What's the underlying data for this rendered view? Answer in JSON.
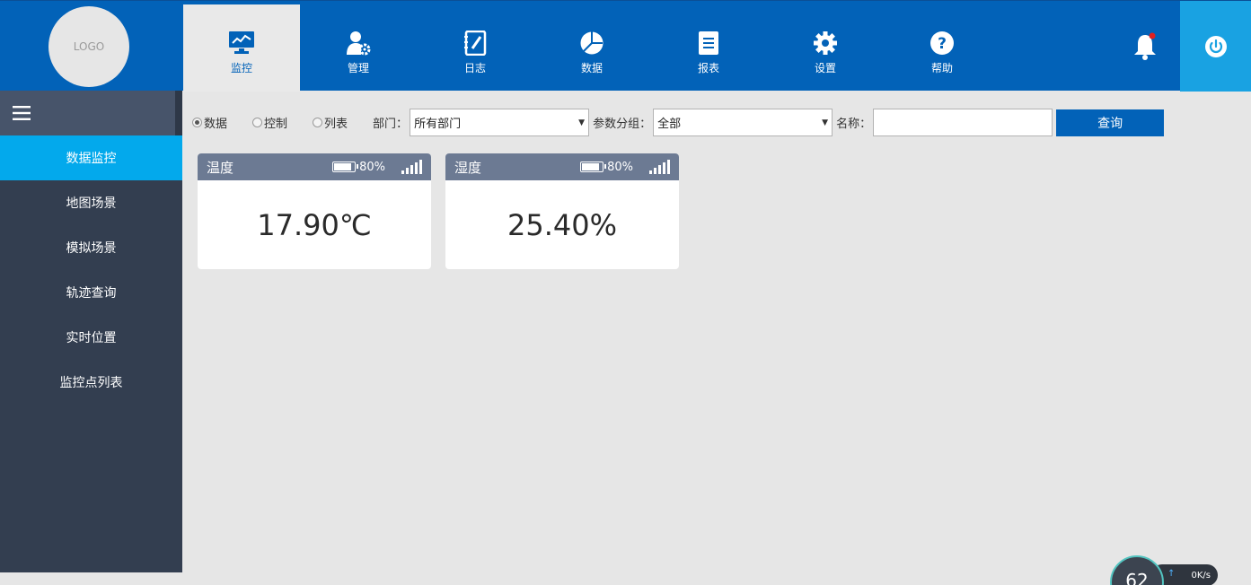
{
  "logo": {
    "text": "LOGO"
  },
  "nav": [
    {
      "label": "监控",
      "icon": "monitor-icon"
    },
    {
      "label": "管理",
      "icon": "user-gear-icon"
    },
    {
      "label": "日志",
      "icon": "notebook-icon"
    },
    {
      "label": "数据",
      "icon": "pie-chart-icon"
    },
    {
      "label": "报表",
      "icon": "report-icon"
    },
    {
      "label": "设置",
      "icon": "gear-icon"
    },
    {
      "label": "帮助",
      "icon": "help-icon"
    }
  ],
  "sidebar": {
    "items": [
      {
        "label": "数据监控"
      },
      {
        "label": "地图场景"
      },
      {
        "label": "模拟场景"
      },
      {
        "label": "轨迹查询"
      },
      {
        "label": "实时位置"
      },
      {
        "label": "监控点列表"
      }
    ]
  },
  "filters": {
    "radios": [
      {
        "label": "数据",
        "checked": true
      },
      {
        "label": "控制",
        "checked": false
      },
      {
        "label": "列表",
        "checked": false
      }
    ],
    "department_label": "部门：",
    "department_value": "所有部门",
    "group_label": "参数分组：",
    "group_value": "全部",
    "name_label": "名称：",
    "name_value": "",
    "query_label": "查询"
  },
  "cards": [
    {
      "title": "温度",
      "battery": "80%",
      "value": "17.90℃"
    },
    {
      "title": "湿度",
      "battery": "80%",
      "value": "25.40%"
    }
  ],
  "speed_widget": {
    "value": "62",
    "rate": "0K/s"
  },
  "colors": {
    "primary": "#0262b8",
    "accent": "#03a9ec",
    "sidebar": "#333e50",
    "card_head": "#6c7a93"
  }
}
